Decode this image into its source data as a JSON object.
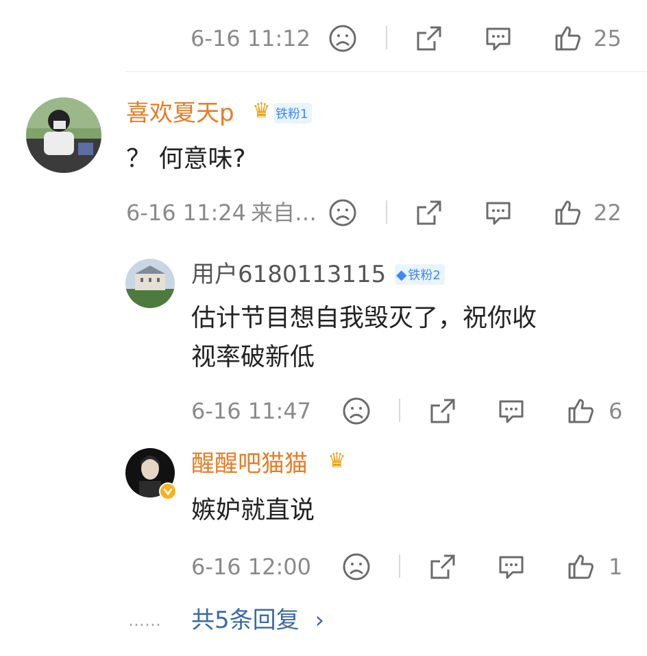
{
  "top_bar": {
    "timestamp": "6-16 11:12",
    "likes": "25"
  },
  "comment": {
    "username": "喜欢夏天p",
    "badge": "铁粉1",
    "text": "？ 何意味?",
    "timestamp": "6-16 11:24",
    "source": "来自…",
    "likes": "22"
  },
  "replies": [
    {
      "username": "用户6180113115",
      "badge": "铁粉2",
      "text_line1": "估计节目想自我毁灭了，祝你收",
      "text_line2": "视率破新低",
      "timestamp": "6-16 11:47",
      "likes": "6"
    },
    {
      "username": "醒醒吧猫猫",
      "text": "嫉妒就直说",
      "timestamp": "6-16 12:00",
      "likes": "1"
    }
  ],
  "more_replies": {
    "dots": "……",
    "label": "共5条回复",
    "chevron": "›"
  },
  "icons": [
    "sad-face-icon",
    "share-icon",
    "comment-icon",
    "thumbs-up-icon",
    "crown-icon",
    "verified-icon",
    "diamond-icon"
  ],
  "colors": {
    "username": "#ea7b24",
    "meta": "#8a8a8a",
    "link": "#3a6aa6",
    "badge_bg": "#eaf4ff",
    "badge_text": "#3d8af7"
  }
}
